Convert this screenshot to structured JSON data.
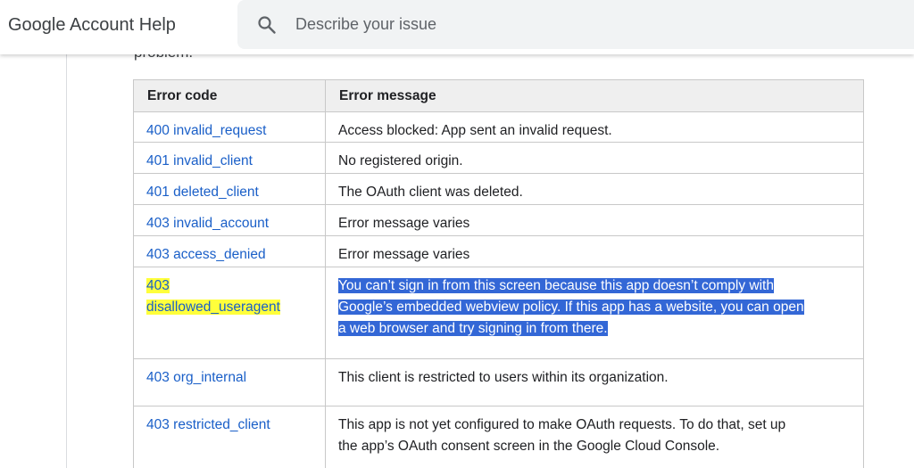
{
  "header": {
    "title": "Google Account Help",
    "search_placeholder": "Describe your issue"
  },
  "intro_fragment": "problem.",
  "table": {
    "headers": [
      "Error code",
      "Error message"
    ],
    "rows": [
      {
        "code": "400 invalid_request",
        "message": "Access blocked: App sent an invalid request."
      },
      {
        "code": "401 invalid_client",
        "message": "No registered origin."
      },
      {
        "code": "401 deleted_client",
        "message": "The OAuth client was deleted."
      },
      {
        "code": "403 invalid_account",
        "message": "Error message varies"
      },
      {
        "code": "403 access_denied",
        "message": "Error message varies"
      },
      {
        "code_line1": "403",
        "code_line2": "disallowed_useragent",
        "message_lines": [
          "You can’t sign in from this screen because this app doesn’t comply with",
          "Google’s embedded webview policy. If this app has a website, you can open",
          "a web browser and try signing in from there."
        ]
      },
      {
        "code": "403 org_internal",
        "message": "This client is restricted to users within its organization."
      },
      {
        "code": "403 restricted_client",
        "message_lines": [
          "This app is not yet configured to make OAuth requests. To do that, set up",
          "the app’s OAuth consent screen in the Google Cloud Console."
        ]
      }
    ]
  },
  "colors": {
    "link": "#1a5fc8",
    "highlight_yellow": "#ffff3b",
    "selection_blue": "#3367d6"
  },
  "icons": {
    "search": "search-icon"
  }
}
